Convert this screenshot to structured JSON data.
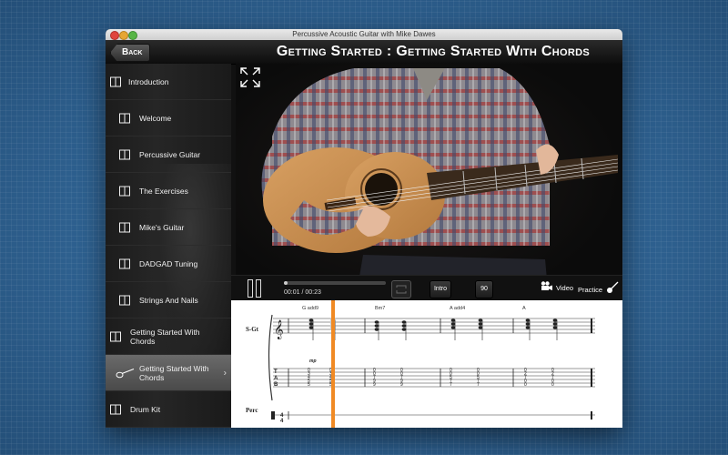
{
  "window": {
    "title": "Percussive Acoustic Guitar with Mike Dawes"
  },
  "header": {
    "back_label": "Back",
    "page_title": "Getting Started : Getting Started With Chords"
  },
  "sidebar": {
    "items": [
      {
        "label": "Introduction",
        "level": 0,
        "active": false
      },
      {
        "label": "Welcome",
        "level": 1,
        "active": false
      },
      {
        "label": "Percussive Guitar",
        "level": 1,
        "active": false
      },
      {
        "label": "The Exercises",
        "level": 1,
        "active": false
      },
      {
        "label": "Mike's Guitar",
        "level": 1,
        "active": false
      },
      {
        "label": "DADGAD Tuning",
        "level": 1,
        "active": false
      },
      {
        "label": "Strings And Nails",
        "level": 1,
        "active": false
      },
      {
        "label": "Getting Started With Chords",
        "level": 0,
        "active": false
      },
      {
        "label": "Getting Started With Chords",
        "level": 1,
        "active": true
      },
      {
        "label": "Drum Kit",
        "level": 0,
        "active": false
      }
    ]
  },
  "player": {
    "current_time": "00:01",
    "total_time": "00:23",
    "time_display": "00:01 / 00:23",
    "progress": 0.04,
    "intro_label": "Intro",
    "tempo": "90",
    "video_label": "Video",
    "practice_label": "Practice"
  },
  "score": {
    "track_labels": [
      "S-Gt",
      "Perc"
    ],
    "chords": [
      "G add9",
      "Bm7",
      "A add4",
      "A"
    ],
    "tab_label": "TAB",
    "mp_label": "mp"
  },
  "colors": {
    "desktop": "#2f6494",
    "playhead": "#f08a24",
    "sidebar_active": "#5a5a5a"
  }
}
